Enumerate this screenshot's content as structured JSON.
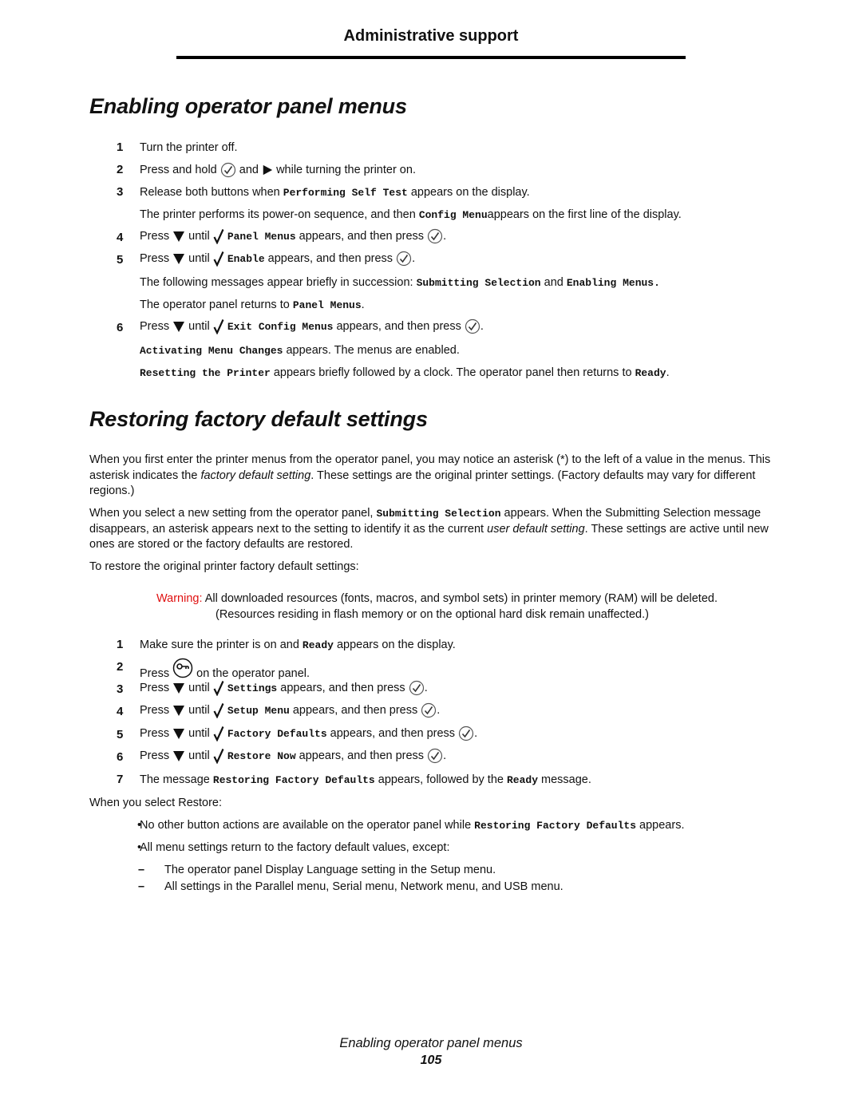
{
  "header": {
    "section": "Administrative support"
  },
  "section1": {
    "title": "Enabling operator panel menus",
    "steps": [
      {
        "num": "1",
        "text": "Turn the printer off."
      },
      {
        "num": "2",
        "pre": "Press and hold",
        "mid": "and",
        "post": "while turning the printer on."
      },
      {
        "num": "3",
        "pre": "Release both buttons when",
        "code": "Performing Self Test",
        "post": "appears on the display."
      },
      {
        "num": "4",
        "pre": "Press",
        "until": "until",
        "code": "Panel Menus",
        "post": "appears, and then press",
        "end": "."
      },
      {
        "num": "5",
        "pre": "Press",
        "until": "until",
        "code": "Enable",
        "post": "appears, and then press",
        "end": "."
      },
      {
        "num": "6",
        "pre": "Press",
        "until": "until",
        "code": "Exit Config Menus",
        "post": "appears, and then press",
        "end": "."
      }
    ],
    "note3": {
      "pre": "The printer performs its power-on sequence, and then",
      "code": "Config Menu",
      "post": "appears on the first line of the display."
    },
    "note5a": {
      "pre": "The following messages appear briefly in succession:",
      "code1": "Submitting Selection",
      "mid": "and",
      "code2": "Enabling Menus."
    },
    "note5b": {
      "pre": "The operator panel returns to",
      "code": "Panel Menus",
      "post": "."
    },
    "note6a": {
      "code": "Activating Menu Changes",
      "post": "appears. The menus are enabled."
    },
    "note6b": {
      "code": "Resetting the Printer",
      "mid": "appears briefly followed by a clock. The operator panel then returns to",
      "code2": "Ready",
      "post": "."
    }
  },
  "section2": {
    "title": "Restoring factory default settings",
    "para1": {
      "pre": "When you first enter the printer menus from the operator panel, you may notice an asterisk (*) to the left of a value in the menus. This asterisk indicates the",
      "em": "factory default setting",
      "post": ". These settings are the original printer settings. (Factory defaults may vary for different regions.)"
    },
    "para2": {
      "pre": "When you select a new setting from the operator panel,",
      "code": "Submitting Selection",
      "mid": "appears. When the Submitting Selection message disappears, an asterisk appears next to the setting to identify it as the current",
      "em": "user default setting",
      "post": ". These settings are active until new ones are stored or the factory defaults are restored."
    },
    "para3": "To restore the original printer factory default settings:",
    "warning": {
      "label": "Warning:",
      "line1": "All downloaded resources (fonts, macros, and symbol sets) in printer memory (RAM) will be deleted.",
      "line2": "(Resources residing in flash memory or on the optional hard disk remain unaffected.)",
      "color": "#e01010"
    },
    "steps": [
      {
        "num": "1",
        "pre": "Make sure the printer is on and",
        "code": "Ready",
        "post": "appears on the display."
      },
      {
        "num": "2",
        "pre": "Press",
        "post": "on the operator panel."
      },
      {
        "num": "3",
        "pre": "Press",
        "until": "until",
        "code": "Settings",
        "post": "appears, and then press",
        "end": "."
      },
      {
        "num": "4",
        "pre": "Press",
        "until": "until",
        "code": "Setup Menu",
        "post": "appears, and then press",
        "end": "."
      },
      {
        "num": "5",
        "pre": "Press",
        "until": "until",
        "code": "Factory Defaults",
        "post": "appears, and then press",
        "end": "."
      },
      {
        "num": "6",
        "pre": "Press",
        "until": "until",
        "code": "Restore Now",
        "post": "appears, and then press",
        "end": "."
      },
      {
        "num": "7",
        "pre": "The message",
        "code": "Restoring Factory Defaults",
        "mid": "appears, followed by the",
        "code2": "Ready",
        "post": "message."
      }
    ],
    "restore_intro": "When you select Restore:",
    "bullets": [
      {
        "pre": "No other button actions are available on the operator panel while",
        "code": "Restoring Factory Defaults",
        "post": "appears."
      },
      {
        "text": "All menu settings return to the factory default values, except:"
      }
    ],
    "sub_bullets": [
      "The operator panel Display Language setting in the Setup menu.",
      "All settings in the Parallel menu, Serial menu, Network menu, and USB menu."
    ],
    "bullet_char": "•",
    "dash_char": "–"
  },
  "footer": {
    "title": "Enabling operator panel menus",
    "page": "105"
  },
  "icons": {
    "select": "select-button-icon",
    "right": "right-arrow-icon",
    "down": "down-arrow-icon",
    "check": "checkmark-icon",
    "menu": "menu-key-icon"
  }
}
